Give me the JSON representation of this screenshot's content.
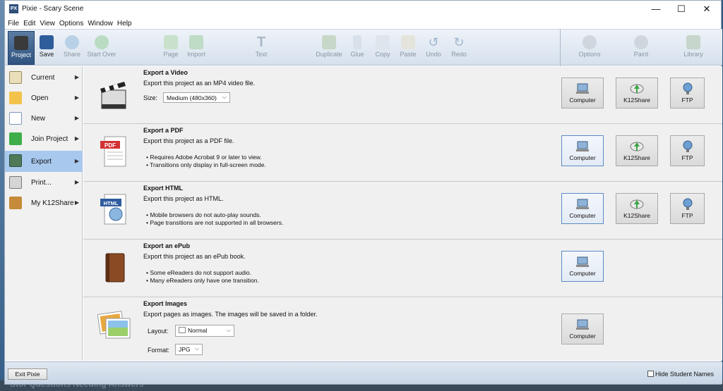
{
  "window": {
    "title": "Pixie - Scary Scene",
    "app_icon_text": "PX",
    "min_glyph": "—",
    "max_glyph": "☐",
    "close_glyph": "✕"
  },
  "menubar": [
    "File",
    "Edit",
    "View",
    "Options",
    "Window",
    "Help"
  ],
  "toolbar": {
    "project": "Project",
    "save": "Save",
    "share": "Share",
    "start_over": "Start Over",
    "page": "Page",
    "import": "Import",
    "text": "Text",
    "duplicate": "Duplicate",
    "glue": "Glue",
    "copy": "Copy",
    "paste": "Paste",
    "undo": "Undo",
    "redo": "Redo",
    "options": "Options",
    "paint": "Paint",
    "library": "Library"
  },
  "leftnav": {
    "current": "Current",
    "open": "Open",
    "new": "New",
    "join": "Join Project",
    "export": "Export",
    "print": "Print...",
    "myk12": "My K12Share",
    "arrow": "▶"
  },
  "rows": {
    "video": {
      "title": "Export a Video",
      "desc": "Export this project as an MP4 video file.",
      "size_label": "Size:",
      "size_value": "Medium (480x360)"
    },
    "pdf": {
      "title": "Export a PDF",
      "desc": "Export this project as a PDF file.",
      "b1": "• Requires Adobe Acrobat 9 or later to view.",
      "b2": "• Transitions only display in full-screen mode.",
      "icon_text": "PDF"
    },
    "html": {
      "title": "Export HTML",
      "desc": "Export this project as HTML.",
      "b1": "• Mobile browsers do not auto-play sounds.",
      "b2": "• Page transitions are not supported in all browsers.",
      "icon_text": "HTML"
    },
    "epub": {
      "title": "Export an ePub",
      "desc": "Export this project as an ePub book.",
      "b1": "• Some eReaders do not support audio.",
      "b2": "• Many eReaders only have one transition."
    },
    "images": {
      "title": "Export Images",
      "desc": "Export pages as images. The images will be saved in a folder.",
      "layout_label": "Layout:",
      "layout_value": "Normal",
      "format_label": "Format:",
      "format_value": "JPG"
    }
  },
  "buttons": {
    "computer": "Computer",
    "k12share": "K12Share",
    "ftp": "FTP"
  },
  "footer": {
    "exit": "Exit Pixie",
    "hide": "Hide Student Names"
  },
  "desktop_fragment": "Stor Questions Needing Answers",
  "colors": {
    "accent": "#a8c8ee",
    "toolbar_active": "#2f5480",
    "focus_border": "#5b8ac4"
  }
}
